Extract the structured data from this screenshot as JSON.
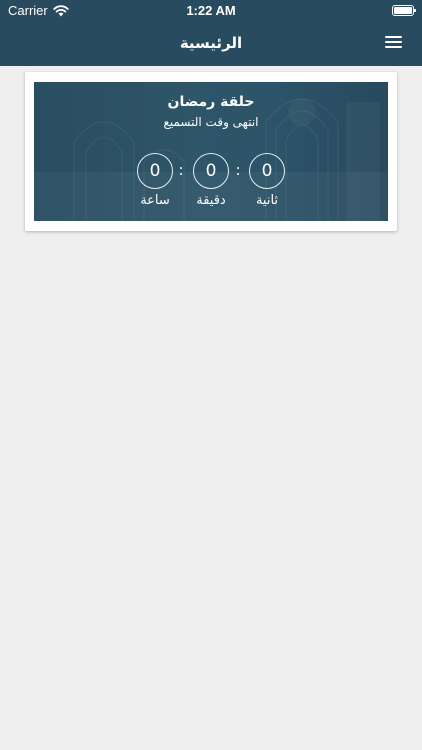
{
  "status_bar": {
    "carrier": "Carrier",
    "time": "1:22 AM"
  },
  "nav": {
    "title": "الرئيسية"
  },
  "card": {
    "title": "حلقة رمضان",
    "subtitle": "انتهى وقت التسميع",
    "countdown": {
      "seconds": {
        "value": "0",
        "label": "ثانية"
      },
      "minutes": {
        "value": "0",
        "label": "دقيقة"
      },
      "hours": {
        "value": "0",
        "label": "ساعة"
      },
      "separator": ":"
    }
  },
  "colors": {
    "header_bg": "#284b60",
    "banner_bg": "#2c5368",
    "page_bg": "#efefef",
    "text_light": "#ffffff"
  },
  "icons": {
    "menu": "hamburger-menu-icon",
    "wifi": "wifi-icon",
    "battery": "battery-icon"
  }
}
